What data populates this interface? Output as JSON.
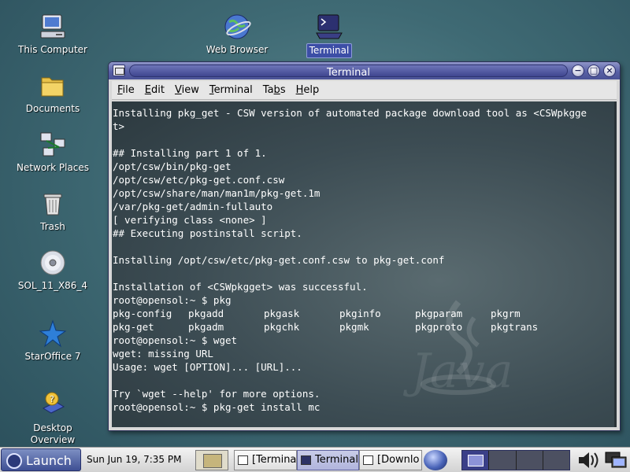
{
  "desktop": {
    "icons": [
      {
        "label": "This Computer",
        "icon": "computer-icon"
      },
      {
        "label": "Documents",
        "icon": "folder-icon"
      },
      {
        "label": "Network Places",
        "icon": "network-icon"
      },
      {
        "label": "Trash",
        "icon": "trash-icon"
      },
      {
        "label": "SOL_11_X86_4",
        "icon": "cd-icon"
      },
      {
        "label": "StarOffice 7",
        "icon": "staroffice-icon"
      },
      {
        "label": "Desktop Overview",
        "icon": "help-book-icon"
      },
      {
        "label": "Web Browser",
        "icon": "browser-globe-icon"
      },
      {
        "label": "Terminal",
        "icon": "terminal-icon"
      }
    ]
  },
  "window": {
    "title": "Terminal",
    "menu": [
      {
        "pre": "",
        "u": "F",
        "post": "ile"
      },
      {
        "pre": "",
        "u": "E",
        "post": "dit"
      },
      {
        "pre": "",
        "u": "V",
        "post": "iew"
      },
      {
        "pre": "",
        "u": "T",
        "post": "erminal"
      },
      {
        "pre": "Ta",
        "u": "b",
        "post": "s"
      },
      {
        "pre": "",
        "u": "H",
        "post": "elp"
      }
    ],
    "terminal_lines": [
      "Installing pkg_get - CSW version of automated package download tool as <CSWpkgge",
      "t>",
      "",
      "## Installing part 1 of 1.",
      "/opt/csw/bin/pkg-get",
      "/opt/csw/etc/pkg-get.conf.csw",
      "/opt/csw/share/man/man1m/pkg-get.1m",
      "/var/pkg-get/admin-fullauto",
      "[ verifying class <none> ]",
      "## Executing postinstall script.",
      "",
      "Installing /opt/csw/etc/pkg-get.conf.csw to pkg-get.conf",
      "",
      "Installation of <CSWpkgget> was successful.",
      "root@opensol:~ $ pkg"
    ],
    "completion_rows": [
      [
        "pkg-config",
        "pkgadd",
        "pkgask",
        "pkginfo",
        "pkgparam",
        "pkgrm"
      ],
      [
        "pkg-get",
        "pkgadm",
        "pkgchk",
        "pkgmk",
        "pkgproto",
        "pkgtrans"
      ]
    ],
    "terminal_lines_after": [
      "root@opensol:~ $ wget",
      "wget: missing URL",
      "Usage: wget [OPTION]... [URL]...",
      "",
      "Try `wget --help' for more options.",
      "root@opensol:~ $ pkg-get install mc"
    ],
    "background_text": "Java"
  },
  "panel": {
    "launch_label": "Launch",
    "clock": "Sun Jun 19,  7:35 PM",
    "tasks": [
      {
        "label": "[Termina",
        "active": false
      },
      {
        "label": "Terminal",
        "active": true
      },
      {
        "label": "[Downlo",
        "active": false
      }
    ]
  },
  "colors": {
    "desktop": "#3f6a74",
    "titlebar": "#5961a6",
    "terminal_bg": "#3c4c53",
    "selection": "#3c4ea6"
  }
}
